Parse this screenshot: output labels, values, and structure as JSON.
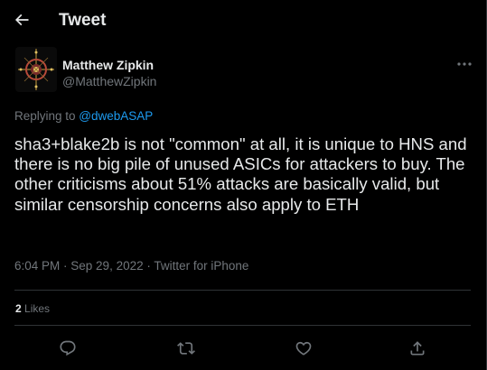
{
  "header": {
    "title": "Tweet",
    "back_icon": "arrow-left-icon"
  },
  "author": {
    "name": "Matthew Zipkin",
    "handle": "@MatthewZipkin"
  },
  "replying": {
    "prefix": "Replying to ",
    "mention": "@dwebASAP"
  },
  "tweet": {
    "text": "sha3+blake2b is not \"common\" at all, it is unique to HNS and there is no big pile of unused ASICs for attackers to buy. The other criticisms about 51% attacks are basically valid, but similar censorship concerns also apply to ETH"
  },
  "meta": {
    "time": "6:04 PM",
    "sep1": " · ",
    "date": "Sep 29, 2022",
    "sep2": " · ",
    "source": "Twitter for iPhone"
  },
  "stats": {
    "likes_count": "2",
    "likes_label": " Likes"
  },
  "actions": [
    {
      "icon": "reply-icon"
    },
    {
      "icon": "retweet-icon"
    },
    {
      "icon": "heart-icon"
    },
    {
      "icon": "share-icon"
    }
  ],
  "colors": {
    "background": "#000000",
    "text": "#e7e9ea",
    "muted": "#71767b",
    "accent": "#1d9bf0",
    "border": "#2f3336"
  }
}
